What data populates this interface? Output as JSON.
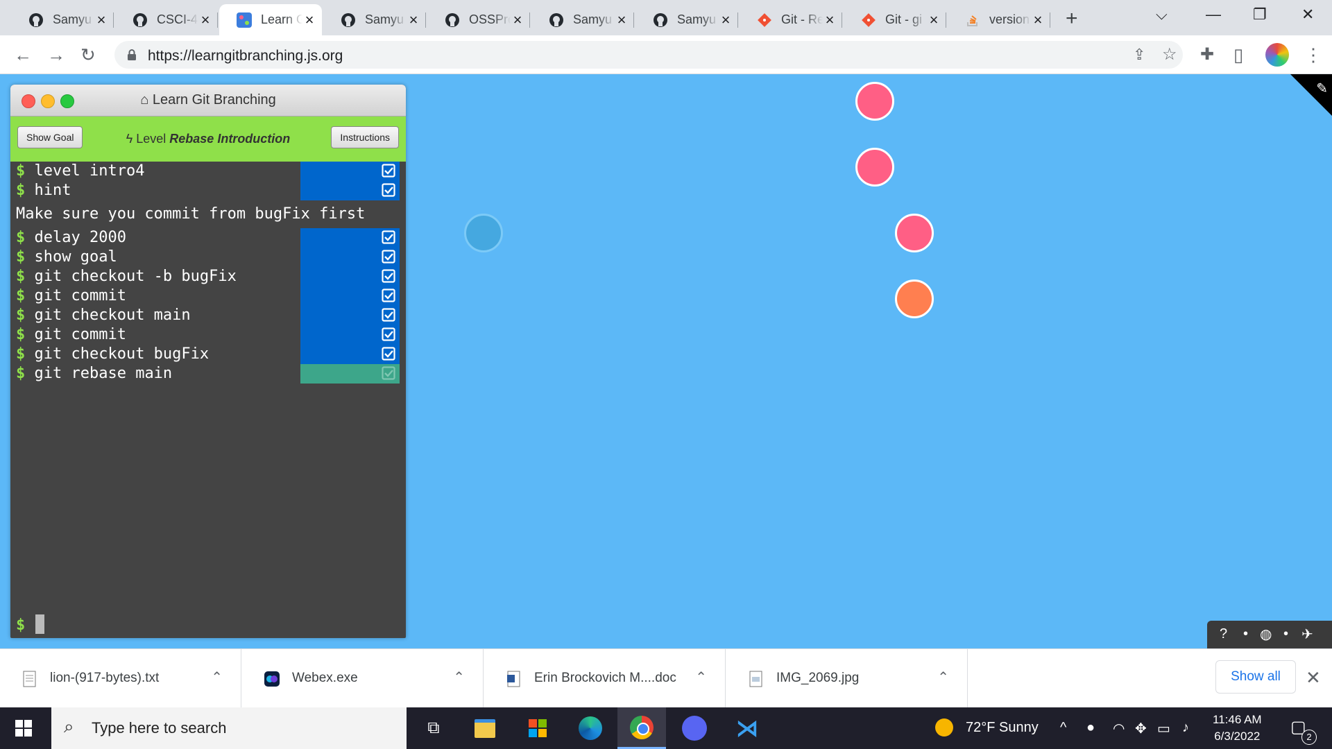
{
  "browser": {
    "tabs": [
      {
        "title": "Samyu",
        "icon": "github-icon",
        "active": false
      },
      {
        "title": "CSCI-4",
        "icon": "github-icon",
        "active": false
      },
      {
        "title": "Learn G",
        "icon": "learngit-icon",
        "active": true
      },
      {
        "title": "Samyu",
        "icon": "github-icon",
        "active": false
      },
      {
        "title": "OSSPro",
        "icon": "github-icon",
        "active": false
      },
      {
        "title": "Samyu",
        "icon": "github-icon",
        "active": false
      },
      {
        "title": "Samyu",
        "icon": "github-icon",
        "active": false
      },
      {
        "title": "Git - Re",
        "icon": "git-icon",
        "active": false
      },
      {
        "title": "Git - gi",
        "icon": "git-icon",
        "active": false
      },
      {
        "title": "version",
        "icon": "stackoverflow-icon",
        "active": false
      }
    ],
    "url": "https://learngitbranching.js.org"
  },
  "lgb": {
    "window_title": "Learn Git Branching",
    "show_goal_label": "Show Goal",
    "instructions_label": "Instructions",
    "level_prefix": "Level",
    "level_name": "Rebase Introduction",
    "prompt_symbol": "$",
    "commands_top": [
      {
        "text": "level intro4",
        "status": "done"
      },
      {
        "text": "hint",
        "status": "done"
      }
    ],
    "hint_text": "Make sure you commit from bugFix first",
    "commands_bottom": [
      {
        "text": "delay 2000",
        "status": "done"
      },
      {
        "text": "show goal",
        "status": "done"
      },
      {
        "text": "git checkout -b bugFix",
        "status": "done"
      },
      {
        "text": "git commit",
        "status": "done"
      },
      {
        "text": "git checkout main",
        "status": "done"
      },
      {
        "text": "git commit",
        "status": "done"
      },
      {
        "text": "git checkout bugFix",
        "status": "done"
      },
      {
        "text": "git rebase main",
        "status": "running"
      }
    ]
  },
  "colors": {
    "background": "#5cb8f7",
    "commit_pink": "#ff5f85",
    "commit_orange": "#ff7f50",
    "commit_ghost": "#45a8e0",
    "done_status": "#0066cc",
    "running_status": "#3da68a",
    "prompt_green": "#8fe04a"
  },
  "downloads": {
    "items": [
      {
        "name": "lion-(917-bytes).txt",
        "icon": "text-file-icon"
      },
      {
        "name": "Webex.exe",
        "icon": "webex-icon"
      },
      {
        "name": "Erin Brockovich M....doc",
        "icon": "word-doc-icon"
      },
      {
        "name": "IMG_2069.jpg",
        "icon": "image-file-icon"
      }
    ],
    "show_all_label": "Show all"
  },
  "taskbar": {
    "search_placeholder": "Type here to search",
    "weather": "72°F  Sunny",
    "time": "11:46 AM",
    "date": "6/3/2022",
    "notification_count": "2"
  }
}
